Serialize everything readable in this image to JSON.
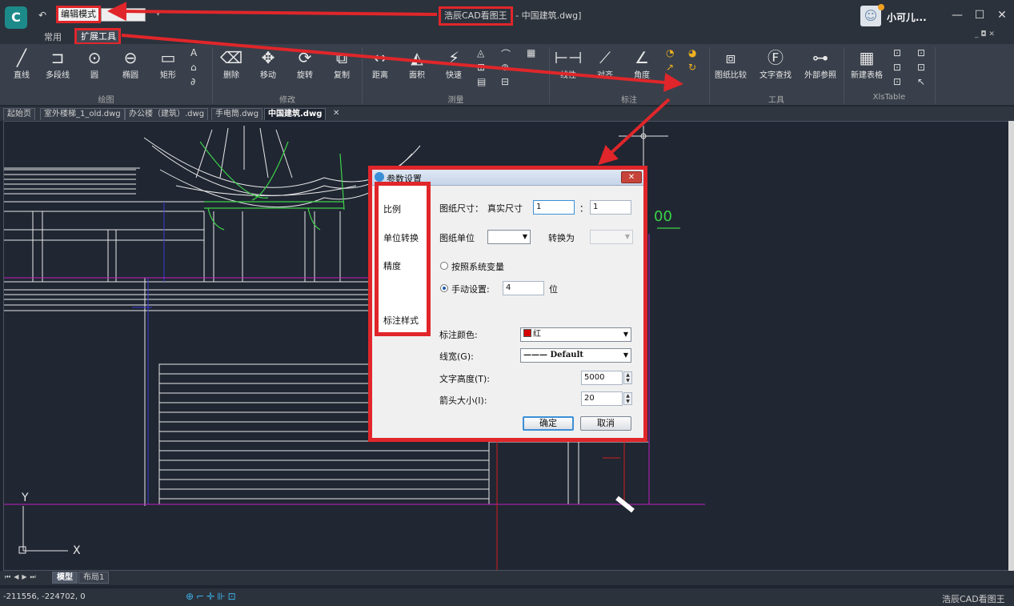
{
  "titlebar": {
    "mode": "编辑模式",
    "title_highlight": "浩辰CAD看图王",
    "title_rest": " - 中国建筑.dwg]",
    "user_name": "小可儿...",
    "minimize": "—",
    "maximize": "☐",
    "close": "✕"
  },
  "ribbon_tabs": {
    "common": "常用",
    "extension": "扩展工具",
    "mdi": "_ ◘ ✕"
  },
  "ribbon": {
    "groups": {
      "draw": "绘图",
      "modify": "修改",
      "measure": "测量",
      "dimension": "标注",
      "tools": "工具",
      "xlstable": "XlsTable"
    },
    "tools": {
      "line": "直线",
      "polyline": "多段线",
      "circle": "圆",
      "ellipse": "椭圆",
      "rectangle": "矩形",
      "delete": "删除",
      "move": "移动",
      "rotate": "旋转",
      "copy": "复制",
      "distance": "距离",
      "area": "面积",
      "quick": "快速",
      "linear": "线性",
      "aligned": "对齐",
      "angle": "角度",
      "compare": "图纸比较",
      "text_find": "文字查找",
      "xref": "外部参照",
      "new_table": "新建表格"
    }
  },
  "doc_tabs": [
    "起始页",
    "室外楼梯_1_old.dwg",
    "办公楼（建筑）.dwg",
    "手电筒.dwg",
    "中国建筑.dwg"
  ],
  "layout_tabs": {
    "model": "模型",
    "layout1": "布局1"
  },
  "statusbar": {
    "coords": "-211556, -224702, 0",
    "brand": "浩辰CAD看图王"
  },
  "canvas": {
    "axis_y": "Y",
    "axis_x": "X",
    "green_text": "00"
  },
  "dialog": {
    "title": "参数设置",
    "close": "✕",
    "categories": [
      "比例",
      "单位转换",
      "精度",
      "标注样式"
    ],
    "scale": {
      "label": "图纸尺寸：",
      "real_label": "真实尺寸",
      "paper_value": "1",
      "colon": "：",
      "real_value": "1"
    },
    "units": {
      "paper_unit_label": "图纸单位",
      "paper_unit_value": "",
      "convert_label": "转换为",
      "convert_value": ""
    },
    "precision": {
      "system_var": "按照系统变量",
      "manual": "手动设置:",
      "manual_value": "4",
      "digits": "位"
    },
    "dimstyle": {
      "color_label": "标注颜色:",
      "color_value": "红",
      "lineweight_label": "线宽(G):",
      "lineweight_value": "——— Default",
      "text_height_label": "文字高度(T):",
      "text_height_value": "5000",
      "arrow_size_label": "箭头大小(I):",
      "arrow_size_value": "20"
    },
    "ok": "确定",
    "cancel": "取消"
  },
  "colors": {
    "highlight": "#e0262a",
    "arrow": "#e0262a",
    "drawing_white": "#e8e8e8",
    "drawing_green": "#3cd24a",
    "drawing_blue": "#3a3ad0",
    "drawing_magenta": "#c020c0",
    "drawing_red": "#d02020"
  }
}
